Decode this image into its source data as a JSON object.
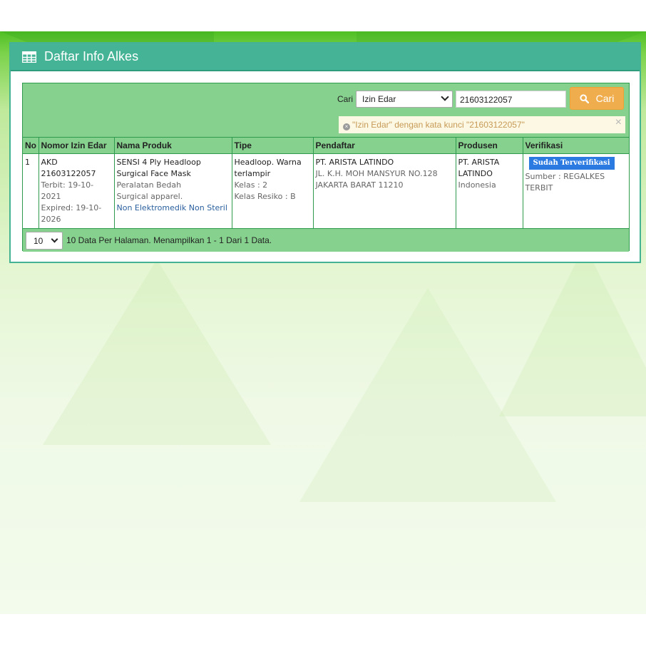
{
  "panel": {
    "title": "Daftar Info Alkes",
    "icon": "table-icon"
  },
  "search": {
    "label": "Cari",
    "category": "Izin Edar",
    "keyword": "21603122057",
    "button": "Cari",
    "filter_notice": "\"Izin Edar\" dengan kata kunci \"21603122057\"",
    "close": "×"
  },
  "table": {
    "headers": [
      "No",
      "Nomor Izin Edar",
      "Nama Produk",
      "Tipe",
      "Pendaftar",
      "Produsen",
      "Verifikasi"
    ],
    "rows": [
      {
        "no": "1",
        "izin": {
          "number": "AKD 21603122057",
          "terbit": "Terbit: 19-10-2021",
          "expired": "Expired: 19-10-2026"
        },
        "produk": {
          "name": "SENSI 4 Ply Headloop Surgical Face Mask",
          "category": "Peralatan Bedah",
          "subcategory": "Surgical apparel.",
          "kind": "Non Elektromedik Non Steril"
        },
        "tipe": {
          "desc": "Headloop. Warna terlampir",
          "kelas": "Kelas : 2",
          "resiko": "Kelas Resiko : B"
        },
        "pendaftar": {
          "name": "PT. ARISTA LATINDO",
          "address": "JL. K.H. MOH MANSYUR NO.128 JAKARTA BARAT 11210"
        },
        "produsen": {
          "name": "PT. ARISTA LATINDO",
          "country": "Indonesia"
        },
        "verifikasi": {
          "badge": "Sudah Terverifikasi",
          "source": "Sumber : REGALKES TERBIT"
        }
      }
    ]
  },
  "pagination": {
    "per_page": "10",
    "summary": "10 Data Per Halaman. Menampilkan 1 - 1 Dari 1 Data."
  },
  "colors": {
    "header": "#45b496",
    "grid": "#85d18d",
    "button": "#f0ad4e",
    "badge": "#2a7ae2"
  }
}
